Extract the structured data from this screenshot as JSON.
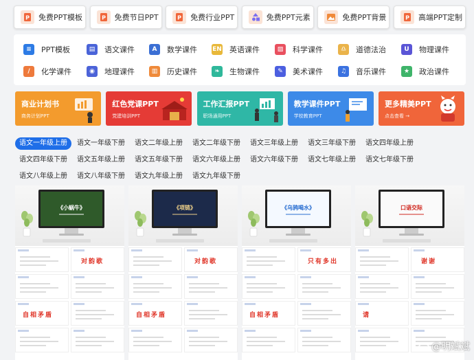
{
  "topnav": [
    {
      "label": "免费PPT模板",
      "icon": "ppt-file-icon",
      "color": "#f0663a"
    },
    {
      "label": "免费节日PPT",
      "icon": "ppt-file-icon",
      "color": "#f0663a"
    },
    {
      "label": "免费行业PPT",
      "icon": "ppt-file-icon",
      "color": "#f0663a"
    },
    {
      "label": "免费PPT元素",
      "icon": "shapes-icon",
      "color": "#7b6ff0"
    },
    {
      "label": "免费PPT背景",
      "icon": "image-icon",
      "color": "#f08a3a"
    },
    {
      "label": "高端PPT定制",
      "icon": "ppt-file-icon",
      "color": "#f0663a"
    }
  ],
  "subjects": [
    {
      "label": "PPT模板",
      "icon": "layers-icon",
      "color": "#2d7be5"
    },
    {
      "label": "语文课件",
      "icon": "book-icon",
      "color": "#4a64d8"
    },
    {
      "label": "数学课件",
      "icon": "compass-icon",
      "color": "#3b6fd4"
    },
    {
      "label": "英语课件",
      "icon": "en-icon",
      "color": "#e8b83a"
    },
    {
      "label": "科学课件",
      "icon": "flask-icon",
      "color": "#e9505f"
    },
    {
      "label": "道德法治",
      "icon": "scale-icon",
      "color": "#eab34a"
    },
    {
      "label": "物理课件",
      "icon": "magnet-icon",
      "color": "#5a55d6"
    },
    {
      "label": "化学课件",
      "icon": "tube-icon",
      "color": "#ee7a3c"
    },
    {
      "label": "地理课件",
      "icon": "globe-icon",
      "color": "#4c63d8"
    },
    {
      "label": "历史课件",
      "icon": "scroll-icon",
      "color": "#ef8a3a"
    },
    {
      "label": "生物课件",
      "icon": "leaf-icon",
      "color": "#2fb89b"
    },
    {
      "label": "美术课件",
      "icon": "palette-icon",
      "color": "#4c5fe0"
    },
    {
      "label": "音乐课件",
      "icon": "music-icon",
      "color": "#3b72e0"
    },
    {
      "label": "政治课件",
      "icon": "star-icon",
      "color": "#3fb46a"
    }
  ],
  "banners": [
    {
      "title": "商业计划书",
      "sub": "商务计划PPT",
      "color": "#f39b2d"
    },
    {
      "title": "红色党课PPT",
      "sub": "党建培训PPT",
      "color": "#e53b36"
    },
    {
      "title": "工作汇报PPT",
      "sub": "职场通用PPT",
      "color": "#2fb7a6"
    },
    {
      "title": "教学课件PPT",
      "sub": "学校教育PPT",
      "color": "#3d8ae8"
    },
    {
      "title": "更多精美PPT",
      "sub": "点击查看 →",
      "color": "#f0653a"
    }
  ],
  "grades": [
    "语文一年级上册",
    "语文一年级下册",
    "语文二年级上册",
    "语文二年级下册",
    "语文三年级上册",
    "语文三年级下册",
    "语文四年级上册",
    "语文四年级下册",
    "语文五年级上册",
    "语文五年级下册",
    "语文六年级上册",
    "语文六年级下册",
    "语文七年级上册",
    "语文七年级下册",
    "语文八年级上册",
    "语文八年级下册",
    "语文九年级上册",
    "语文九年级下册"
  ],
  "cards": [
    {
      "screen_title": "《小蜗牛》",
      "thumb_text": [
        "对韵歌",
        "自相矛盾"
      ]
    },
    {
      "screen_title": "《项链》",
      "thumb_text": [
        "对韵歌",
        "自相矛盾"
      ]
    },
    {
      "screen_title": "《乌鸦喝水》",
      "thumb_text": [
        "只有多出",
        "自相矛盾"
      ]
    },
    {
      "screen_title": "口语交际",
      "thumb_text": [
        "谢谢",
        "请"
      ]
    }
  ],
  "watermark": "@明斌斌"
}
